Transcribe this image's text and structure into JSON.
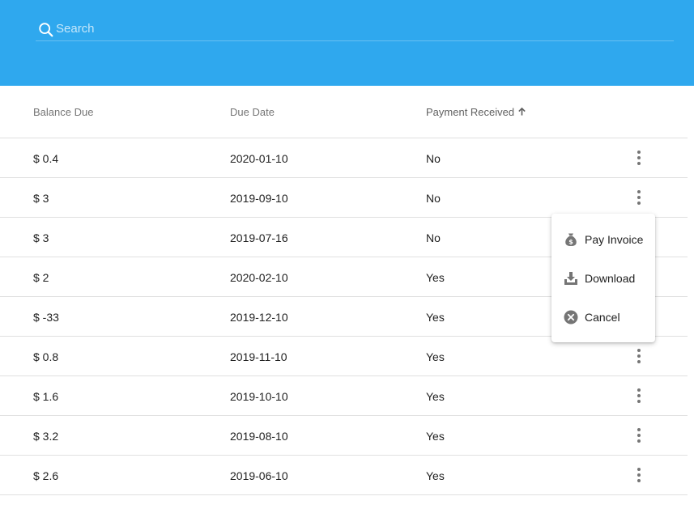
{
  "search": {
    "placeholder": "Search",
    "value": ""
  },
  "table": {
    "columns": [
      {
        "label": "Balance Due"
      },
      {
        "label": "Due Date"
      },
      {
        "label": "Payment Received",
        "sort": "ascending"
      }
    ],
    "rows": [
      {
        "balance": "$ 0.4",
        "due_date": "2020-01-10",
        "paid": "No"
      },
      {
        "balance": "$ 3",
        "due_date": "2019-09-10",
        "paid": "No"
      },
      {
        "balance": "$ 3",
        "due_date": "2019-07-16",
        "paid": "No"
      },
      {
        "balance": "$ 2",
        "due_date": "2020-02-10",
        "paid": "Yes"
      },
      {
        "balance": "$ -33",
        "due_date": "2019-12-10",
        "paid": "Yes"
      },
      {
        "balance": "$ 0.8",
        "due_date": "2019-11-10",
        "paid": "Yes"
      },
      {
        "balance": "$ 1.6",
        "due_date": "2019-10-10",
        "paid": "Yes"
      },
      {
        "balance": "$ 3.2",
        "due_date": "2019-08-10",
        "paid": "Yes"
      },
      {
        "balance": "$ 2.6",
        "due_date": "2019-06-10",
        "paid": "Yes"
      }
    ]
  },
  "row_menu": {
    "open_for_row": 2,
    "items": [
      {
        "label": "Pay Invoice",
        "icon": "money-bag-icon"
      },
      {
        "label": "Download",
        "icon": "download-icon"
      },
      {
        "label": "Cancel",
        "icon": "cancel-circle-icon"
      }
    ]
  },
  "colors": {
    "app_bar": "#2fa8ee",
    "divider": "#e0e0e0",
    "icon_gray": "#757575"
  }
}
